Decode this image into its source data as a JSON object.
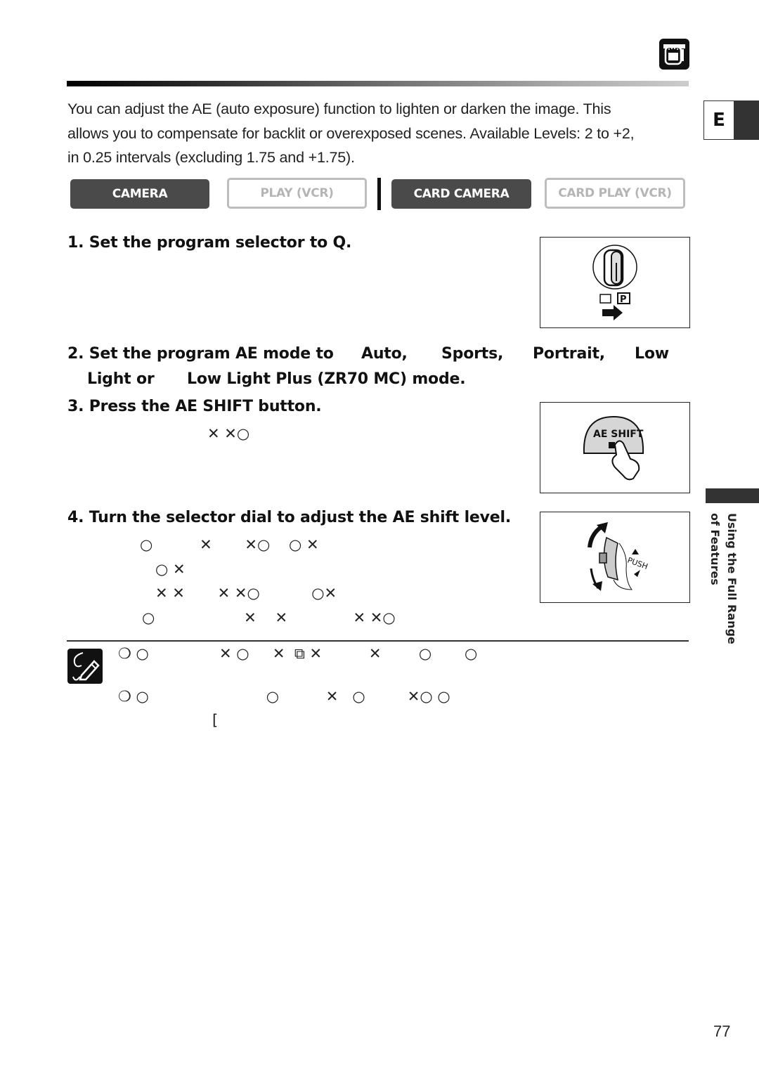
{
  "header": {
    "camera_icon": "camera-mode-icon",
    "language_tab": "E"
  },
  "intro": {
    "lines": [
      "You can adjust the AE (auto exposure) function to lighten or darken the image. This",
      "allows you to compensate for backlit or overexposed scenes. Available Levels:  2 to +2,",
      "in 0.25 intervals (excluding   1.75 and +1.75)."
    ]
  },
  "modes": [
    {
      "label": "CAMERA",
      "active": true
    },
    {
      "label": "PLAY (VCR)",
      "active": false
    },
    {
      "label": "CARD CAMERA",
      "active": true
    },
    {
      "label": "CARD PLAY (VCR)",
      "active": false
    }
  ],
  "steps": {
    "s1": "1. Set the program selector to Q.",
    "s2_line1": [
      "2. Set the program AE mode to",
      "Auto,",
      "Sports,",
      "Portrait,",
      "Low"
    ],
    "s2_line2": [
      "Light or",
      "Low Light Plus (ZR70 MC) mode."
    ],
    "s3": "3. Press the AE SHIFT button.",
    "s3_sub": "✕ ✕○",
    "s4": "4. Turn the selector dial to adjust the AE shift level.",
    "s4_sub": [
      {
        "text": "○          ✕       ✕○    ○ ✕",
        "indent": "a"
      },
      {
        "text": "○ ✕",
        "indent": "b"
      },
      {
        "text": "✕ ✕       ✕ ✕○           ○✕",
        "indent": "b"
      },
      {
        "text": "○                   ✕    ✕              ✕ ✕○",
        "indent": "a"
      }
    ]
  },
  "figures": {
    "fig1": {
      "label_p": "P"
    },
    "fig2": {
      "button_label": "AE SHIFT"
    },
    "fig3": {
      "push_label": "PUSH"
    }
  },
  "notes": {
    "icon": "note-pencil-icon",
    "line1": "❍ ○               ✕ ○     ✕  ⧉ ✕          ✕        ○       ○",
    "line2": "❍ ○                         ○          ✕   ○         ✕○ ○",
    "line3": "[",
    "inline_icon": "play-card-icon"
  },
  "sidebar": {
    "line1": "Using  the  Full Range",
    "line2": "of Features"
  },
  "page_number": "77"
}
